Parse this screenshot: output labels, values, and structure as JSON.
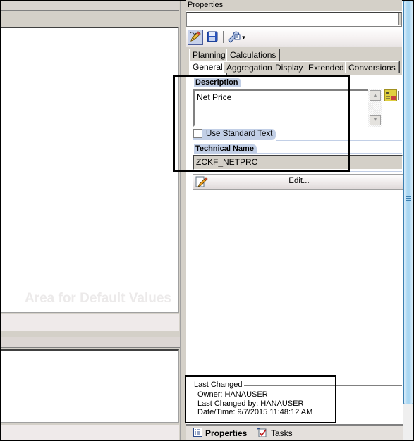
{
  "left_pane": {
    "watermark": "Area for Default Values"
  },
  "properties": {
    "title": "Properties",
    "object_field_value": "",
    "toolbar": {
      "edit_icon": "pencil-icon",
      "save_icon": "save-icon",
      "tools_icon": "wrench-icon",
      "tools_dropdown": "▾"
    },
    "tabs_row1": [
      {
        "label": "Planning"
      },
      {
        "label": "Calculations"
      }
    ],
    "tabs_row2": [
      {
        "label": "General",
        "active": true
      },
      {
        "label": "Aggregation"
      },
      {
        "label": "Display"
      },
      {
        "label": "Extended"
      },
      {
        "label": "Conversions"
      }
    ],
    "general": {
      "description_label": "Description",
      "description_value": "Net Price",
      "use_standard_text_label": "Use Standard Text",
      "use_standard_text_checked": false,
      "technical_name_label": "Technical Name",
      "technical_name_value": "ZCKF_NETPRC",
      "edit_button_label": "Edit..."
    },
    "last_changed": {
      "title": "Last Changed",
      "owner": "Owner: HANAUSER",
      "changed_by": "Last Changed by: HANAUSER",
      "datetime": "Date/Time: 9/7/2015 11:48:12 AM"
    },
    "bottom_tabs": [
      {
        "label": "Properties",
        "active": true,
        "icon": "properties-icon"
      },
      {
        "label": "Tasks",
        "icon": "tasks-icon"
      }
    ]
  },
  "colors": {
    "section_label_bg": "#c2cfe6",
    "scrollbar_thumb": "#a8d6f2",
    "panel_bg": "#d4d0c8"
  }
}
